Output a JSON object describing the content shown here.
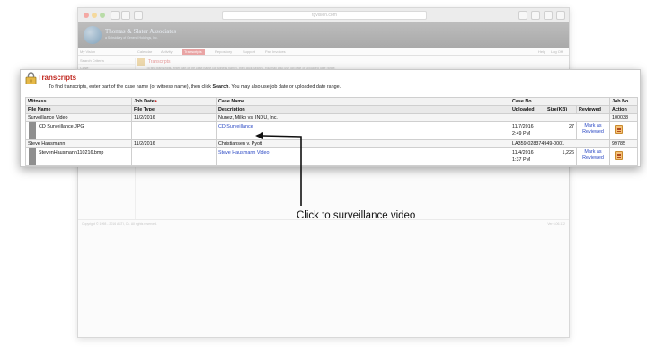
{
  "browser": {
    "url": "tgvision.com",
    "logo_title": "Thomas & Slater Associates",
    "logo_subtitle": "a Subsidiary of General Holdings, Inc.",
    "menu": {
      "my_vision": "My Vision",
      "calendar": "Calendar",
      "activity": "Activity",
      "transcripts": "Transcripts",
      "repository": "Repository",
      "support": "Support",
      "pay_invoices": "Pay Invoices",
      "help": "Help",
      "log_off": "Log Off"
    },
    "sidebar": {
      "search_criteria": "Search Criteria",
      "case": "Case:"
    },
    "section_title": "Transcripts",
    "hint": "To find transcripts, enter part of the case name (or witness name), then click Search. You may also use job date or uploaded date range.",
    "copyright": "Copyright © 1998 - 2016 ASTI, Co. All rights reserved.",
    "version": "Ver 6.06.112"
  },
  "panel": {
    "title": "Transcripts",
    "hint_pre": "To find transcripts, enter part of the case name (or witness name), then click ",
    "hint_bold": "Search",
    "hint_post": ". You may also use job date or uploaded date range.",
    "headers_row1": {
      "witness": "Witness",
      "job_date": "Job Date",
      "job_date_marker": "●",
      "case_name": "Case Name",
      "case_no": "Case No.",
      "job_no": "Job No."
    },
    "headers_row2": {
      "file_name": "File Name",
      "file_type": "File Type",
      "description": "Description",
      "uploaded": "Uploaded",
      "size": "Size(KB)",
      "reviewed": "Reviewed",
      "action": "Action"
    },
    "rows": [
      {
        "witness": "Surveillance Video",
        "job_date": "11/2/2016",
        "case_name": "Nunez, Milko vs. INDU, Inc.",
        "case_no": "",
        "job_no": "100038",
        "file_name": "CD Surveillance.JPG",
        "file_type": "",
        "description": "CD Surveillance",
        "uploaded_date": "11/7/2016",
        "uploaded_time": "2:49 PM",
        "size": "27",
        "reviewed_line1": "Mark as",
        "reviewed_line2": "Reviewed"
      },
      {
        "witness": "Steve Hausmann",
        "job_date": "11/2/2016",
        "case_name": "Christiansen v. Pyott",
        "case_no": "LA359-028374949-0001",
        "job_no": "99785",
        "file_name": "StevenHausmann110216.bmp",
        "file_type": "",
        "description": "Steve Hausmann Video",
        "uploaded_date": "11/4/2016",
        "uploaded_time": "1:37 PM",
        "size": "1,226",
        "reviewed_line1": "Mark as",
        "reviewed_line2": "Reviewed"
      }
    ]
  },
  "annotation": {
    "text": "Click to surveillance video"
  },
  "icons": {
    "lock": "lock-icon",
    "pdf": "pdf-document-icon",
    "arrow": "callout-arrow"
  },
  "colors": {
    "title_red": "#c0271f",
    "link_blue": "#2a48c4",
    "tab_active": "#e9a4a4"
  }
}
